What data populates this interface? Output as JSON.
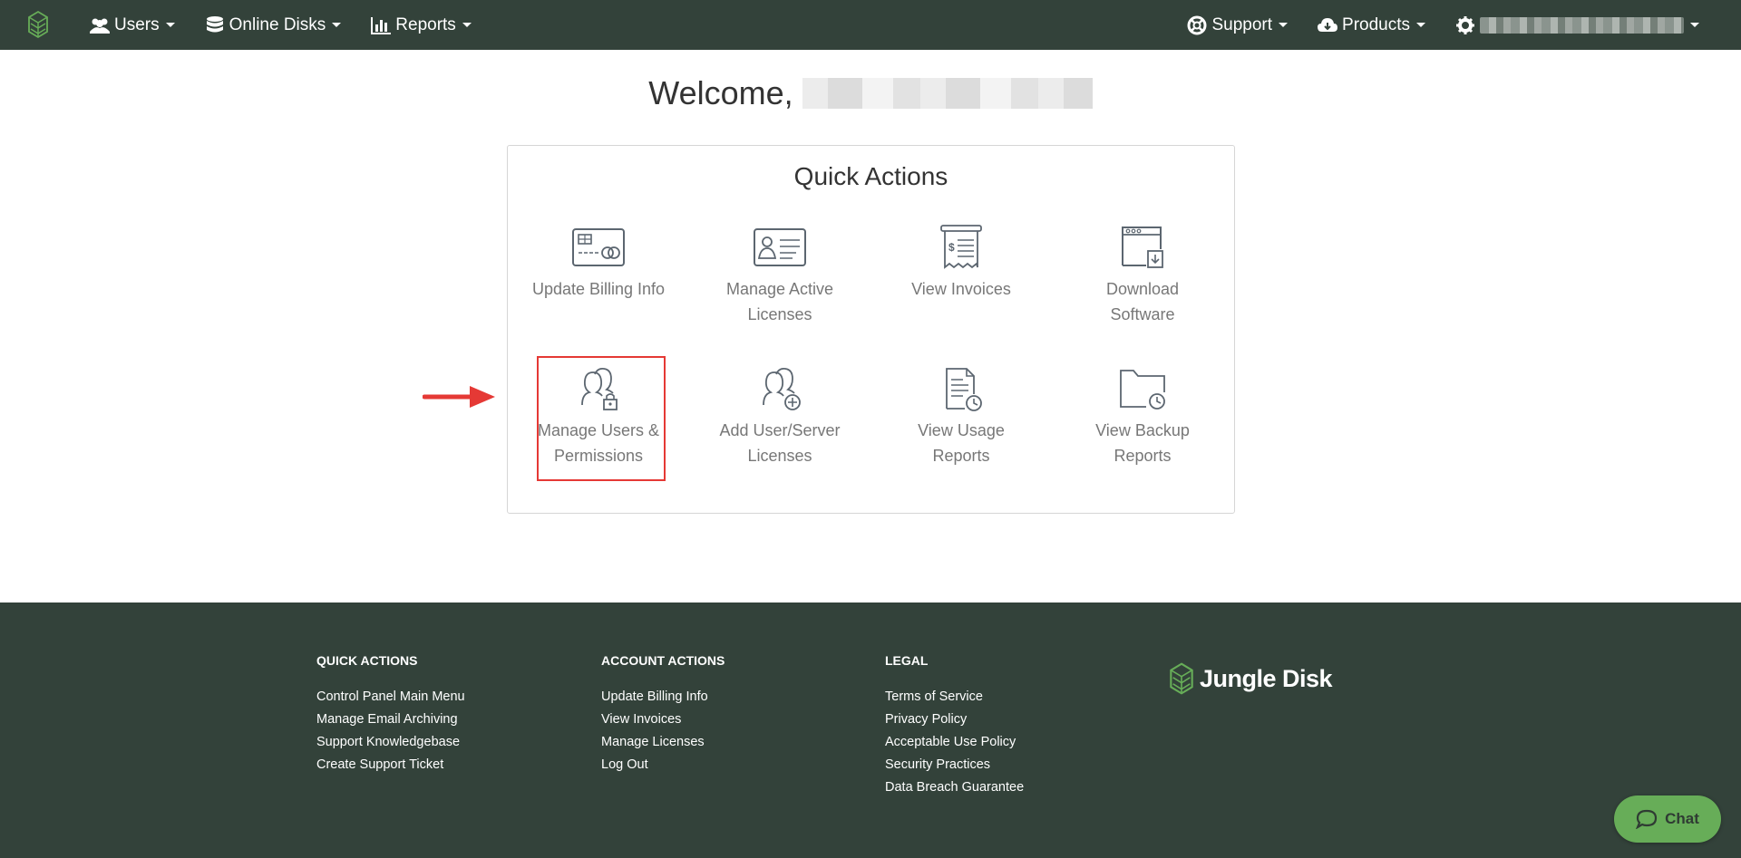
{
  "nav": {
    "left": [
      {
        "label": "Users",
        "icon": "users-icon"
      },
      {
        "label": "Online Disks",
        "icon": "database-icon"
      },
      {
        "label": "Reports",
        "icon": "bar-chart-icon"
      }
    ],
    "support_label": "Support",
    "products_label": "Products"
  },
  "welcome": {
    "text": "Welcome,"
  },
  "quick_actions": {
    "title": "Quick Actions",
    "items": [
      {
        "line1": "Update Billing Info",
        "line2": "",
        "icon": "credit-card-icon"
      },
      {
        "line1": "Manage Active",
        "line2": "Licenses",
        "icon": "license-card-icon"
      },
      {
        "line1": "View Invoices",
        "line2": "",
        "icon": "invoice-icon"
      },
      {
        "line1": "Download",
        "line2": "Software",
        "icon": "download-window-icon"
      },
      {
        "line1": "Manage Users &",
        "line2": "Permissions",
        "icon": "users-lock-icon"
      },
      {
        "line1": "Add User/Server",
        "line2": "Licenses",
        "icon": "users-add-icon"
      },
      {
        "line1": "View Usage",
        "line2": "Reports",
        "icon": "document-clock-icon"
      },
      {
        "line1": "View Backup",
        "line2": "Reports",
        "icon": "folder-clock-icon"
      }
    ]
  },
  "footer": {
    "quick_actions": {
      "heading": "QUICK ACTIONS",
      "links": [
        "Control Panel Main Menu",
        "Manage Email Archiving",
        "Support Knowledgebase",
        "Create Support Ticket"
      ]
    },
    "account_actions": {
      "heading": "ACCOUNT ACTIONS",
      "links": [
        "Update Billing Info",
        "View Invoices",
        "Manage Licenses",
        "Log Out"
      ]
    },
    "legal": {
      "heading": "LEGAL",
      "links": [
        "Terms of Service",
        "Privacy Policy",
        "Acceptable Use Policy",
        "Security Practices",
        "Data Breach Guarantee"
      ]
    },
    "brand": "Jungle Disk"
  },
  "chat": {
    "label": "Chat"
  },
  "colors": {
    "nav_bg": "#33423a",
    "brand_green": "#67ad58",
    "highlight": "#e53935"
  }
}
